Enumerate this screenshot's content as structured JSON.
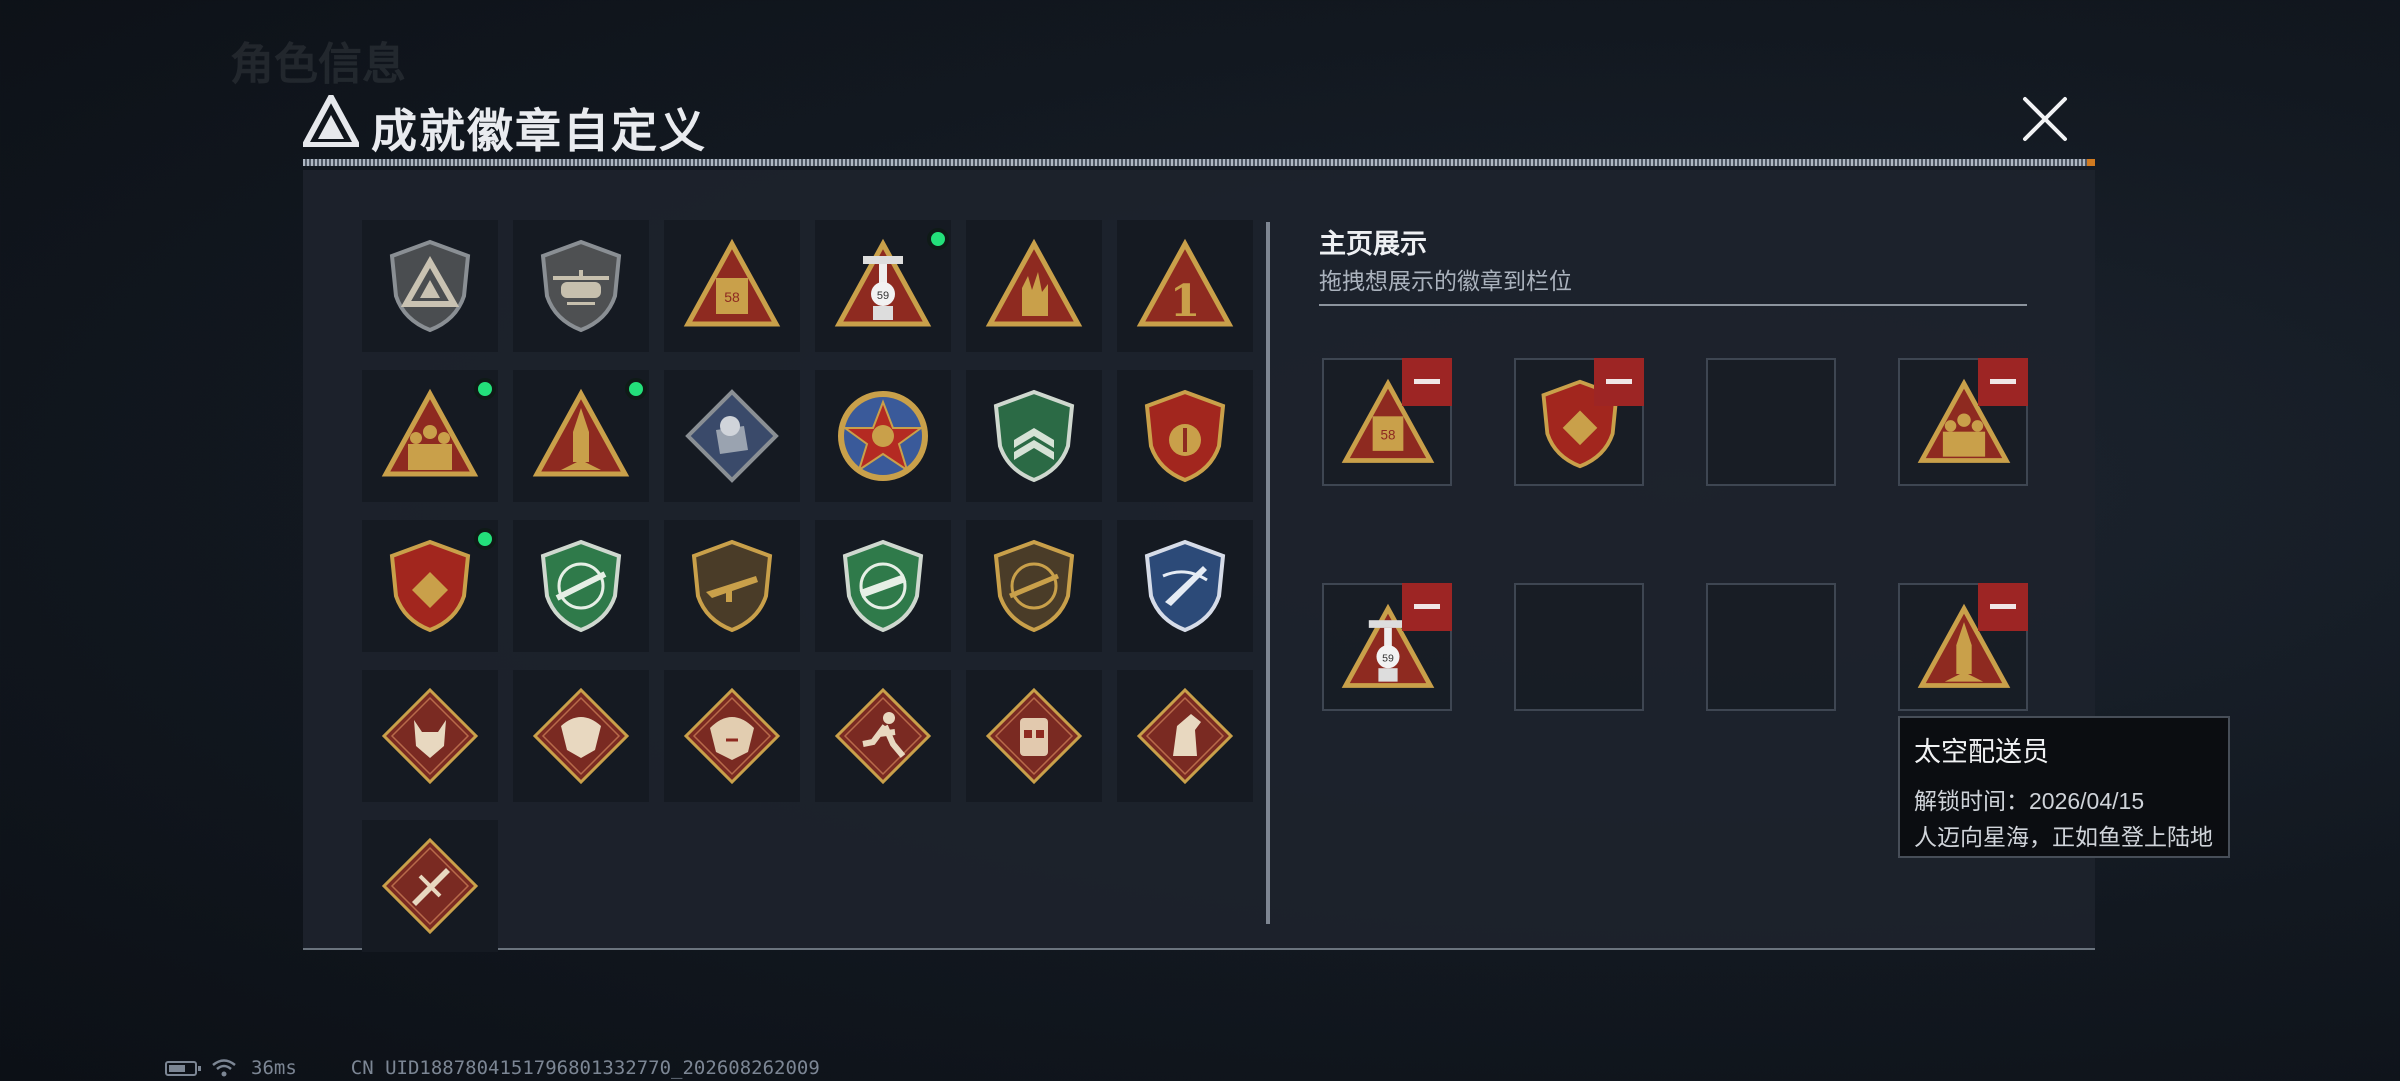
{
  "background_title": "角色信息",
  "status": {
    "ping": "36ms",
    "uid": "CN UID1887804151796801332770_202608262009"
  },
  "modal": {
    "title": "成就徽章自定义",
    "close_icon": "close-icon"
  },
  "badges": [
    {
      "icon": "emblem-shield-gray-icon",
      "new": false
    },
    {
      "icon": "helicopter-shield-icon",
      "new": false
    },
    {
      "icon": "crate-58-triangle-icon",
      "new": false
    },
    {
      "icon": "rocket-59-triangle-icon",
      "new": true
    },
    {
      "icon": "hand-gesture-triangle-icon",
      "new": false
    },
    {
      "icon": "number-one-triangle-icon",
      "new": false
    },
    {
      "icon": "soldiers-triangle-icon",
      "new": true
    },
    {
      "icon": "rocket-launch-triangle-icon",
      "new": true
    },
    {
      "icon": "fist-diamond-icon",
      "new": false
    },
    {
      "icon": "star-medal-icon",
      "new": false
    },
    {
      "icon": "green-chevron-shield-icon",
      "new": false
    },
    {
      "icon": "winged-shield-icon",
      "new": false
    },
    {
      "icon": "red-gold-crest-icon",
      "new": true
    },
    {
      "icon": "green-crosshair-rifle-icon",
      "new": false
    },
    {
      "icon": "gold-rifle-shield-icon",
      "new": false
    },
    {
      "icon": "green-smg-shield-icon",
      "new": false
    },
    {
      "icon": "gold-rifle-scope-shield-icon",
      "new": false
    },
    {
      "icon": "blue-knife-shield-icon",
      "new": false
    },
    {
      "icon": "wolf-diamond-icon",
      "new": false
    },
    {
      "icon": "dragon-diamond-icon",
      "new": false
    },
    {
      "icon": "dragon-fire-diamond-icon",
      "new": false
    },
    {
      "icon": "running-soldier-diamond-icon",
      "new": false
    },
    {
      "icon": "vest-armor-diamond-icon",
      "new": false
    },
    {
      "icon": "horse-diamond-icon",
      "new": false
    },
    {
      "icon": "scalpel-diamond-icon",
      "new": false
    }
  ],
  "showcase": {
    "title": "主页展示",
    "subtitle": "拖拽想展示的徽章到栏位",
    "slots": [
      {
        "icon": "crate-58-triangle-icon",
        "filled": true
      },
      {
        "icon": "red-gold-crest-icon",
        "filled": true
      },
      {
        "icon": "",
        "filled": false
      },
      {
        "icon": "soldiers-triangle-icon",
        "filled": true
      },
      {
        "icon": "rocket-59-triangle-icon",
        "filled": true
      },
      {
        "icon": "",
        "filled": false
      },
      {
        "icon": "",
        "filled": false
      },
      {
        "icon": "rocket-launch-triangle-icon",
        "filled": true
      }
    ]
  },
  "tooltip": {
    "name": "太空配送员",
    "unlock_time": "解锁时间：2026/04/15",
    "description": "人迈向星海，正如鱼登上陆地"
  },
  "colors": {
    "accent_green": "#23e07a",
    "remove_red": "#9d2524",
    "gold": "#c9a04a",
    "panel": "#1d232c"
  }
}
